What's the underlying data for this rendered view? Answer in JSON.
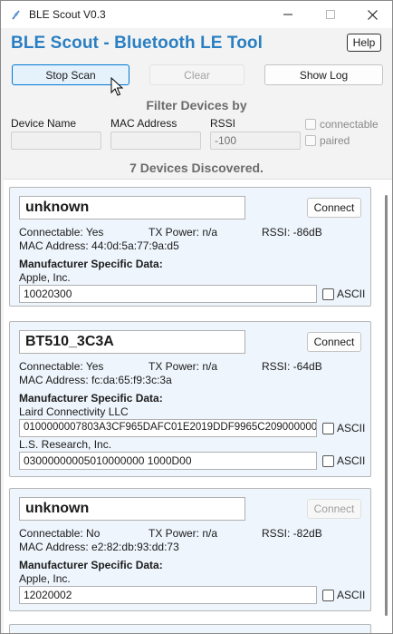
{
  "window": {
    "title": "BLE Scout V0.3"
  },
  "header": {
    "title": "BLE Scout - Bluetooth LE Tool",
    "help_label": "Help"
  },
  "toolbar": {
    "stop_scan_label": "Stop Scan",
    "clear_label": "Clear",
    "show_log_label": "Show Log"
  },
  "filter": {
    "title": "Filter Devices by",
    "device_name_label": "Device Name",
    "mac_label": "MAC Address",
    "rssi_label": "RSSI",
    "device_name_value": "",
    "mac_value": "",
    "rssi_value": "-100",
    "connectable_label": "connectable",
    "paired_label": "paired"
  },
  "status": {
    "discovered_text": "7 Devices Discovered."
  },
  "devices": [
    {
      "name": "unknown",
      "connect_label": "Connect",
      "connectable": "Connectable: Yes",
      "tx_power": "TX Power: n/a",
      "rssi": "RSSI: -86dB",
      "mac": "MAC Address: 44:0d:5a:77:9a:d5",
      "msd_title": "Manufacturer Specific Data:",
      "manufacturers": [
        {
          "name": "Apple, Inc.",
          "data": "10020300",
          "ascii_label": "ASCII"
        }
      ]
    },
    {
      "name": "BT510_3C3A",
      "connect_label": "Connect",
      "connectable": "Connectable: Yes",
      "tx_power": "TX Power: n/a",
      "rssi": "RSSI: -64dB",
      "mac": "MAC Address: fc:da:65:f9:3c:3a",
      "msd_title": "Manufacturer Specific Data:",
      "manufacturers": [
        {
          "name": "Laird Connectivity LLC",
          "data": "0100000007803A3CF965DAFC01E2019DDF9965C209000000",
          "ascii_label": "ASCII"
        },
        {
          "name": "L.S. Research, Inc.",
          "data": "03000000005010000000 1000D00",
          "ascii_label": "ASCII"
        }
      ]
    },
    {
      "name": "unknown",
      "connect_label": "Connect",
      "connectable": "Connectable: No",
      "tx_power": "TX Power: n/a",
      "rssi": "RSSI: -82dB",
      "mac": "MAC Address: e2:82:db:93:dd:73",
      "msd_title": "Manufacturer Specific Data:",
      "manufacturers": [
        {
          "name": "Apple, Inc.",
          "data": "12020002",
          "ascii_label": "ASCII"
        }
      ]
    }
  ]
}
